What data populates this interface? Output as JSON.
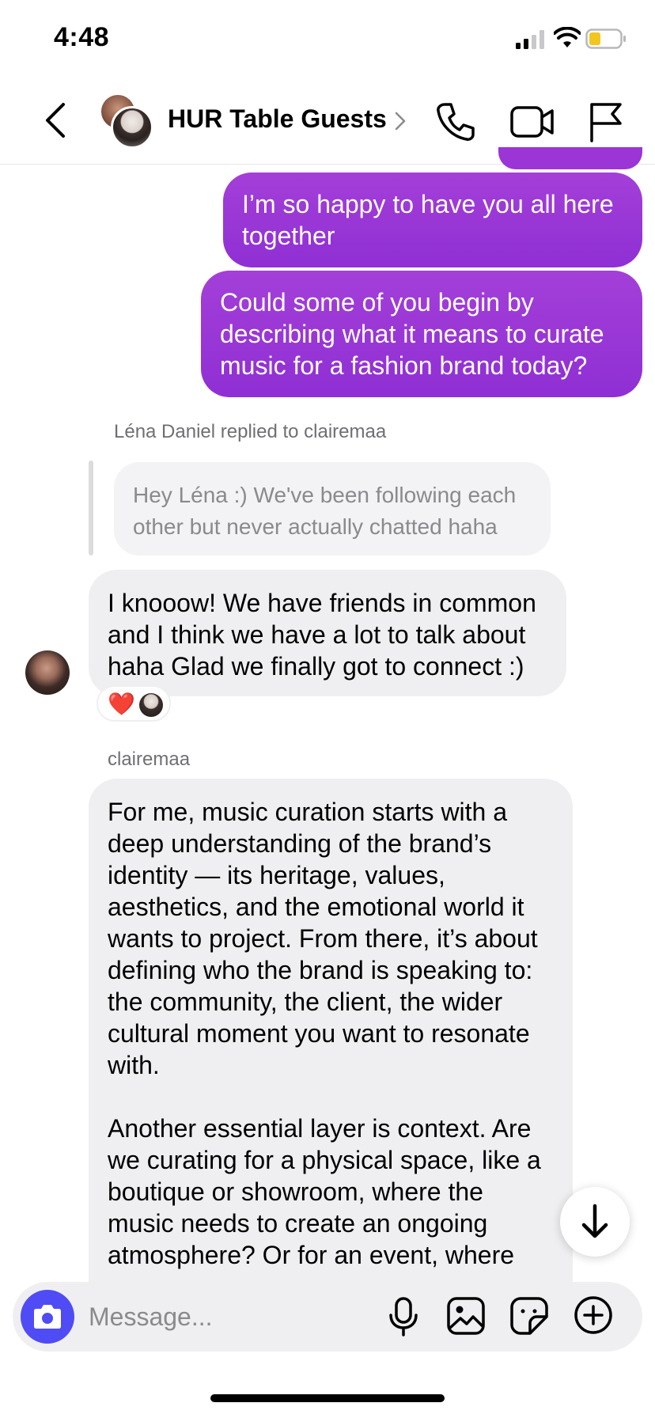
{
  "status_bar": {
    "time": "4:48"
  },
  "header": {
    "title": "HUR Table Guests",
    "icons": [
      "back-arrow-icon",
      "chevron-right-icon",
      "phone-icon",
      "video-camera-icon",
      "flag-icon"
    ]
  },
  "messages": {
    "outgoing": [
      "I’m so happy to have you all here together",
      "Could some of you begin by describing what it means to curate music for a fashion brand today?"
    ],
    "reply_label": "Léna Daniel replied to clairemaa",
    "reply_quote": "Hey Léna :) We've been following each other but never actually chatted haha",
    "reply_message": "I knooow! We have friends in common and I think we have a lot to talk about haha Glad we finally got to connect :)",
    "reaction": "❤️",
    "sender_name": "clairemaa",
    "long_message_paragraphs": [
      "For me, music curation starts with a deep understanding of the brand’s identity — its heritage, values, aesthetics, and the emotional world it wants to project. From there, it’s about defining who the brand is speaking to: the community, the client, the wider cultural moment you want to resonate with.",
      "Another essential layer is context. Are we curating for a physical space, like a boutique or showroom, where the music needs to create an ongoing atmosphere? Or for an event, where"
    ]
  },
  "composer": {
    "placeholder": "Message...",
    "icons": [
      "camera-icon",
      "microphone-icon",
      "gallery-icon",
      "sticker-icon",
      "plus-icon"
    ]
  },
  "colors": {
    "outgoing_bubble": "#9b35d6",
    "incoming_bubble": "#efeff1",
    "camera_button": "#4f4cf5"
  }
}
